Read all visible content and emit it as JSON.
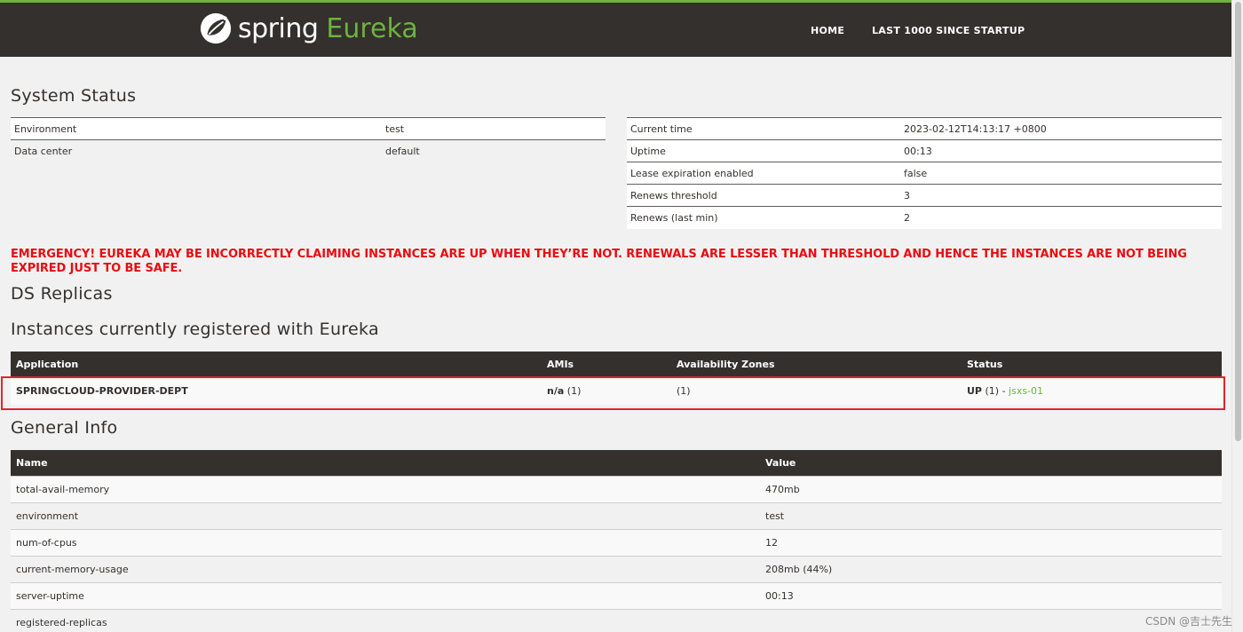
{
  "brand": {
    "spring": "spring",
    "eureka": "Eureka"
  },
  "nav": {
    "home": "HOME",
    "last1000": "LAST 1000 SINCE STARTUP"
  },
  "system_status": {
    "title": "System Status",
    "left": [
      {
        "label": "Environment",
        "value": "test"
      },
      {
        "label": "Data center",
        "value": "default"
      }
    ],
    "right": [
      {
        "label": "Current time",
        "value": "2023-02-12T14:13:17 +0800"
      },
      {
        "label": "Uptime",
        "value": "00:13"
      },
      {
        "label": "Lease expiration enabled",
        "value": "false"
      },
      {
        "label": "Renews threshold",
        "value": "3"
      },
      {
        "label": "Renews (last min)",
        "value": "2"
      }
    ]
  },
  "emergency": "EMERGENCY! EUREKA MAY BE INCORRECTLY CLAIMING INSTANCES ARE UP WHEN THEY’RE NOT. RENEWALS ARE LESSER THAN THRESHOLD AND HENCE THE INSTANCES ARE NOT BEING EXPIRED JUST TO BE SAFE.",
  "ds_replicas": {
    "title": "DS Replicas"
  },
  "instances": {
    "title": "Instances currently registered with Eureka",
    "headers": [
      "Application",
      "AMIs",
      "Availability Zones",
      "Status"
    ],
    "rows": [
      {
        "application": "SPRINGCLOUD-PROVIDER-DEPT",
        "ami_bold": "n/a",
        "ami_count": " (1)",
        "zones": "(1)",
        "status_bold": "UP",
        "status_count": " (1) - ",
        "instance_link": "jsxs-01"
      }
    ]
  },
  "general_info": {
    "title": "General Info",
    "headers": [
      "Name",
      "Value"
    ],
    "rows": [
      {
        "name": "total-avail-memory",
        "value": "470mb"
      },
      {
        "name": "environment",
        "value": "test"
      },
      {
        "name": "num-of-cpus",
        "value": "12"
      },
      {
        "name": "current-memory-usage",
        "value": "208mb (44%)"
      },
      {
        "name": "server-uptime",
        "value": "00:13"
      },
      {
        "name": "registered-replicas",
        "value": ""
      }
    ]
  },
  "watermark": "CSDN @吉士先生",
  "colors": {
    "brand_green": "#6db33f",
    "bar_dark": "#34302d",
    "emergency_red": "#e80c10",
    "highlight_red": "#e3242b"
  }
}
